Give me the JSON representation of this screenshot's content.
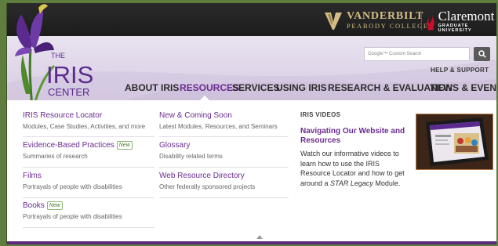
{
  "header": {
    "vanderbilt_name": "VANDERBILT",
    "vanderbilt_sub": "PEABODY COLLEGE",
    "claremont_name": "Claremont",
    "claremont_sub": "GRADUATE UNIVERSITY"
  },
  "logo": {
    "line1": "THE",
    "line2": "IRIS",
    "line3": "CENTER"
  },
  "search": {
    "placeholder": "Google™ Custom Search",
    "icon": "search-icon"
  },
  "help_link": "HELP & SUPPORT",
  "nav": {
    "items": [
      "ABOUT IRIS",
      "RESOURCES",
      "SERVICES",
      "USING IRIS",
      "RESEARCH & EVALUATION",
      "NEWS & EVENTS"
    ],
    "active": "RESOURCES"
  },
  "menu": {
    "col1": [
      {
        "title": "IRIS Resource Locator",
        "desc": "Modules, Case Studies, Activities, and more"
      },
      {
        "title": "Evidence-Based Practices",
        "badge": "New",
        "desc": "Summaries of research"
      },
      {
        "title": "Films",
        "desc": "Portrayals of people with disabilities"
      },
      {
        "title": "Books",
        "badge": "New",
        "desc": "Portrayals of people with disabilities"
      }
    ],
    "col2": [
      {
        "title": "New & Coming Soon",
        "desc": "Latest Modules, Resources, and Seminars"
      },
      {
        "title": "Glossary",
        "desc": "Disability related terms"
      },
      {
        "title": "Web Resource Directory",
        "desc": "Other federally sponsored projects"
      }
    ],
    "videos": {
      "heading": "IRIS VIDEOS",
      "title": "Navigating Our Website and Resources",
      "body_pre": "Watch our informative videos to learn how to use the IRIS Resource Locator and how to get around a ",
      "body_em": "STAR Legacy",
      "body_post": " Module."
    }
  },
  "colors": {
    "accent": "#6b2c91",
    "page_bg": "#5f7d3f",
    "topbar": "#1f1f1f",
    "gold": "#d3bd84"
  }
}
